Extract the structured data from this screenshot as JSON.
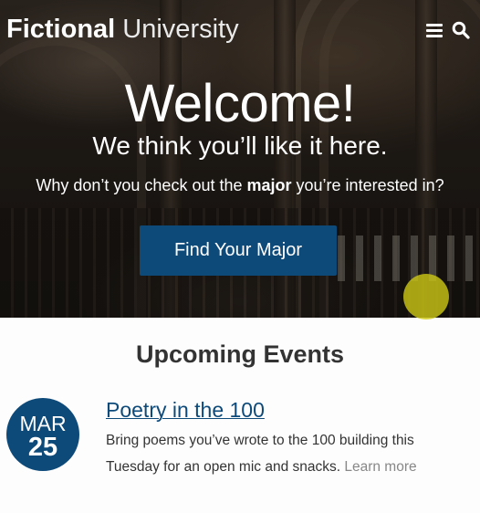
{
  "header": {
    "brand_bold": "Fictional",
    "brand_light": "University",
    "icons": [
      "menu-icon",
      "search-icon"
    ]
  },
  "hero": {
    "heading": "Welcome!",
    "subheading": "We think you’ll like it here.",
    "prompt_before": "Why don’t you check out the ",
    "prompt_bold": "major",
    "prompt_after": " you’re interested in?",
    "cta_label": "Find Your Major"
  },
  "events": {
    "title": "Upcoming Events",
    "items": [
      {
        "month": "MAR",
        "day": "25",
        "title": "Poetry in the 100",
        "description": "Bring poems you’ve wrote to the 100 building this Tuesday for an open mic and snacks.",
        "link_label": "Learn more"
      }
    ]
  },
  "colors": {
    "primary": "#0d4a7a",
    "highlight": "#cdc814"
  }
}
